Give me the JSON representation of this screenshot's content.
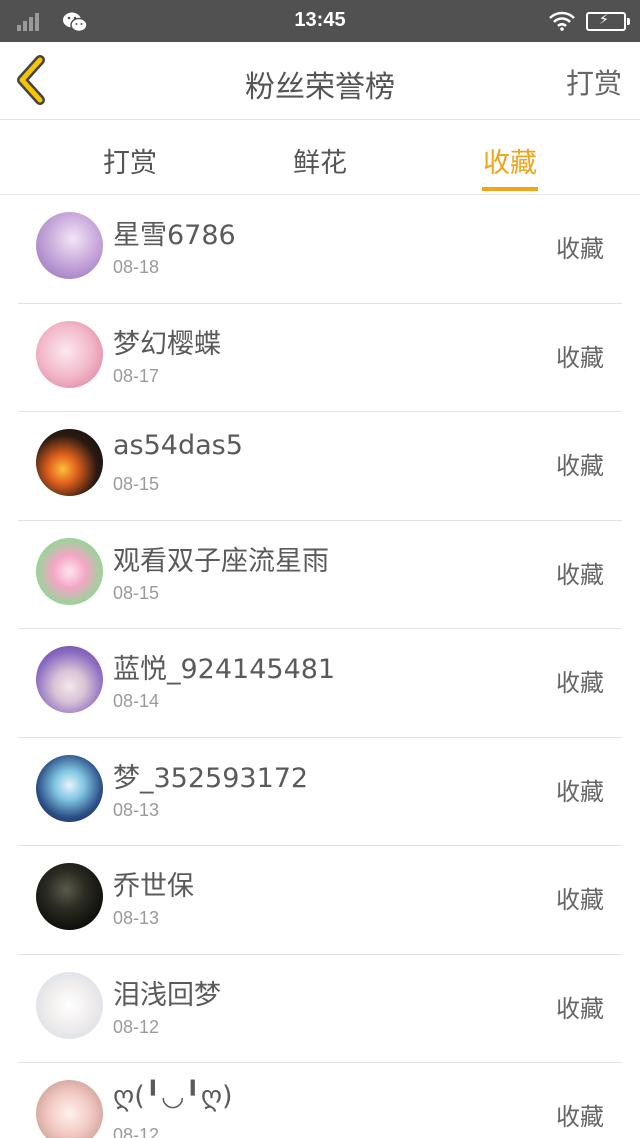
{
  "status_bar": {
    "time": "13:45"
  },
  "header": {
    "title": "粉丝荣誉榜",
    "right_link": "打赏"
  },
  "tabs": [
    {
      "label": "打赏"
    },
    {
      "label": "鲜花"
    },
    {
      "label": "收藏"
    }
  ],
  "active_tab": "收藏",
  "colors": {
    "accent": "#f0a418",
    "status_bar": "#515151"
  },
  "list": [
    {
      "name": "星雪6786",
      "date": "08-18",
      "action": "收藏"
    },
    {
      "name": "梦幻樱蝶",
      "date": "08-17",
      "action": "收藏"
    },
    {
      "name": "as54das5",
      "date": "08-15",
      "action": "收藏"
    },
    {
      "name": "观看双子座流星雨",
      "date": "08-15",
      "action": "收藏"
    },
    {
      "name": "蓝悦_924145481",
      "date": "08-14",
      "action": "收藏"
    },
    {
      "name": "梦_352593172",
      "date": "08-13",
      "action": "收藏"
    },
    {
      "name": "乔世保",
      "date": "08-13",
      "action": "收藏"
    },
    {
      "name": "泪浅回梦",
      "date": "08-12",
      "action": "收藏"
    },
    {
      "name": "ღ(╹◡╹ღ)",
      "date": "08-12",
      "action": "收藏"
    }
  ]
}
